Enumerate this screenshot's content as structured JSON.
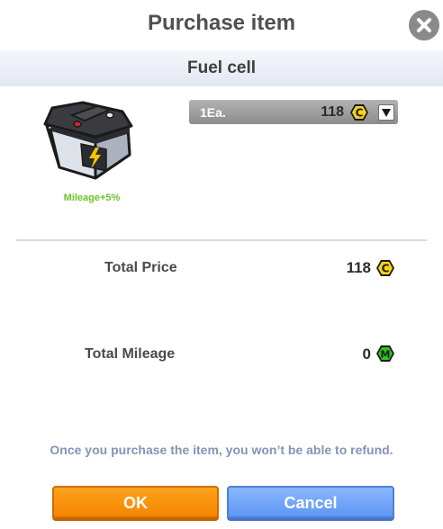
{
  "dialog": {
    "title": "Purchase item",
    "item_name": "Fuel cell",
    "item_bonus": "Mileage+5%",
    "quantity_label": "1Ea.",
    "unit_price": "118",
    "total_price_label": "Total Price",
    "total_price_value": "118",
    "total_mileage_label": "Total Mileage",
    "total_mileage_value": "0",
    "notice": "Once you purchase the item, you won’t be able to refund.",
    "ok_label": "OK",
    "cancel_label": "Cancel",
    "coin_letter": "C",
    "mileage_letter": "M"
  },
  "icons": [
    "close-icon",
    "battery-icon",
    "coin-icon",
    "mileage-icon",
    "chevron-down-icon"
  ],
  "colors": {
    "coin": "#f7d417",
    "mileage": "#2ec41e",
    "bonus_text": "#6cc42c",
    "ok_button": "#f58500",
    "cancel_button": "#5e97f3"
  }
}
